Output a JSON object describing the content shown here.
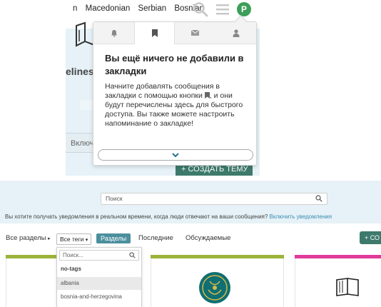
{
  "header": {
    "languages": [
      "n",
      "Macedonian",
      "Serbian",
      "Bosnian"
    ],
    "avatar_letter": "P",
    "accent_color": "#3d9e5a"
  },
  "background": {
    "elines_text": "elines",
    "include_btn": "Включи",
    "create_btn": "+ СОЗДАТЬ ТЕМУ"
  },
  "popup": {
    "tabs": [
      "bell-icon",
      "bookmark-icon",
      "envelope-icon",
      "user-icon"
    ],
    "active_tab": 1,
    "title": "Вы ещё ничего не добавили в закладки",
    "text_before_icon": "Начните добавлять сообщения в закладки с помощью кнопки",
    "text_after_icon": ", и они будут перечислены здесь для быстрого доступа. Вы также можете настроить напоминание о закладке!"
  },
  "bottom": {
    "search_placeholder": "Поиск",
    "notify_text": "Вы хотите получать уведомления в реальном времени, когда люди отвечают на ваши сообщения?",
    "notify_link": "Включить уведомления",
    "filters": {
      "all_sections": "Все разделы",
      "all_tags": "Все теги",
      "sections": "Разделы",
      "latest": "Последние",
      "discussed": "Обсуждаемые"
    },
    "create_short": "+ СО",
    "tag_dropdown": {
      "search_placeholder": "Поиск...",
      "items": [
        "no-tags",
        "albania",
        "bosnia-and-herzegovina"
      ]
    },
    "card_colors": [
      "#9bb33a",
      "#9bb33a",
      "#e03a9a"
    ]
  }
}
